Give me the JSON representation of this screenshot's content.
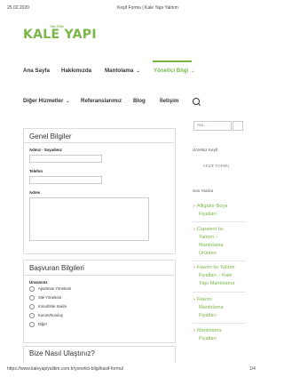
{
  "print_header": {
    "date": "25.02.2020",
    "title": "Keşif Formu | Kale Yapı Yalıtım"
  },
  "logo": {
    "brand": "KALE YAPI",
    "tagline": "YALITIM"
  },
  "nav": {
    "row1": [
      {
        "label": "Ana Sayfa"
      },
      {
        "label": "Hakkımızda"
      },
      {
        "label": "Mantolama",
        "chevron": "⌄"
      },
      {
        "label": "Yönetici Bilgi",
        "chevron": "⌄",
        "active": true
      }
    ],
    "row2": [
      {
        "label": "Diğer Hizmetler",
        "chevron": "⌄"
      },
      {
        "label": "Referanslarımız"
      },
      {
        "label": "Blog"
      },
      {
        "label": "İletişim"
      }
    ],
    "search_icon": "search-icon",
    "accent_color": "#7ab648"
  },
  "form": {
    "section1_title": "Genel Bilgiler",
    "name_label": "Adınız - Soyadınız",
    "phone_label": "Telefon",
    "address_label": "Adres",
    "section2_title": "Başvuran Bilgileri",
    "applicant_label": "Ünvanınız",
    "options": [
      "Apartman Yöneticisi",
      "Site Yöneticisi",
      "Konut/Site Sakini",
      "Kurum/Kuruluş",
      "Diğer"
    ],
    "section3_title": "Bize Nasıl Ulaştınız?"
  },
  "sidebar": {
    "search_placeholder": "Ara...",
    "pages_heading": "Ücretsiz Keşif",
    "pages_link": "KEŞİF FORMU",
    "posts_heading": "Son Yazılar",
    "posts": [
      [
        "Alligator Boya",
        "Fiyatları"
      ],
      [
        "Capatect Isı",
        "Yalıtım –",
        "Mantolama",
        "Ürünleri"
      ],
      [
        "Fawori Isı Yalıtım",
        "Fiyatları – Kale",
        "Yapı Mantolama"
      ],
      [
        "Fawori",
        "Mantolama",
        "Fiyatları"
      ],
      [
        "Mantolama",
        "Fiyatları"
      ]
    ]
  },
  "print_footer": {
    "url": "https://www.kaleyapiyalitim.com.tr/yonetici-bilgi/kasif-formu/",
    "page": "1/4"
  }
}
